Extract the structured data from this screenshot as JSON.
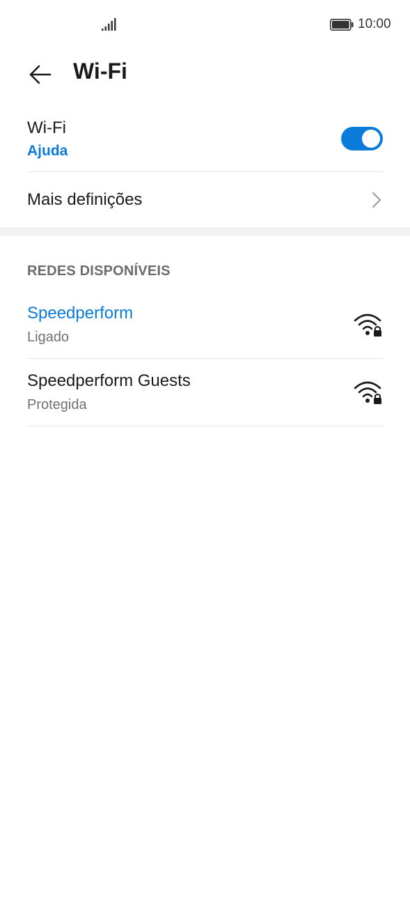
{
  "status_bar": {
    "time": "10:00",
    "signal_icon": "signal-bars-icon",
    "battery_icon": "battery-icon"
  },
  "header": {
    "title": "Wi-Fi",
    "back_icon": "arrow-left-icon"
  },
  "wifi_toggle": {
    "label": "Wi-Fi",
    "help": "Ajuda",
    "enabled": true
  },
  "more_settings": {
    "label": "Mais definições"
  },
  "networks_section": {
    "title": "REDES DISPONÍVEIS",
    "networks": [
      {
        "name": "Speedperform",
        "status": "Ligado",
        "connected": true
      },
      {
        "name": "Speedperform Guests",
        "status": "Protegida",
        "connected": false
      }
    ]
  },
  "colors": {
    "accent": "#0a7bd9",
    "divider": "#e5e5e5",
    "band": "#f2f2f2"
  }
}
